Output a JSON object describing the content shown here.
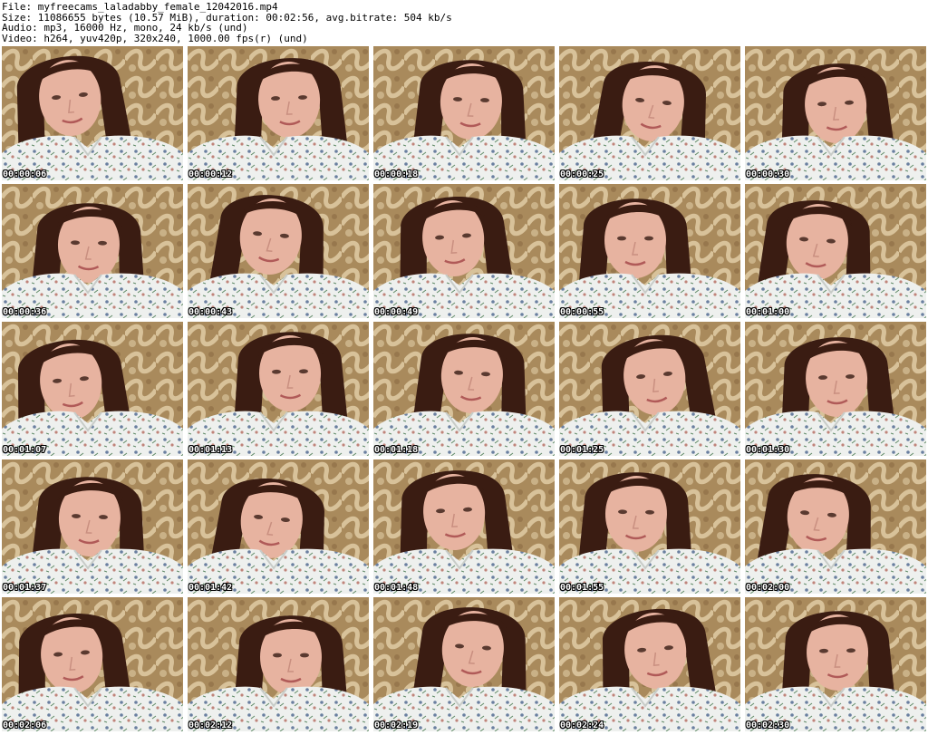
{
  "header": {
    "file_line": "File: myfreecams_laladabby_female_12042016.mp4",
    "size_line": "Size: 11086655 bytes (10.57 MiB), duration: 00:02:56, avg.bitrate: 504 kb/s",
    "audio_line": "Audio: mp3, 16000 Hz, mono, 24 kb/s (und)",
    "video_line": "Video: h264, yuv420p, 320x240, 1000.00 fps(r) (und)"
  },
  "thumbnails": [
    {
      "timestamp": "00:00:06"
    },
    {
      "timestamp": "00:00:12"
    },
    {
      "timestamp": "00:00:18"
    },
    {
      "timestamp": "00:00:25"
    },
    {
      "timestamp": "00:00:30"
    },
    {
      "timestamp": "00:00:36"
    },
    {
      "timestamp": "00:00:43"
    },
    {
      "timestamp": "00:00:49"
    },
    {
      "timestamp": "00:00:55"
    },
    {
      "timestamp": "00:01:00"
    },
    {
      "timestamp": "00:01:07"
    },
    {
      "timestamp": "00:01:13"
    },
    {
      "timestamp": "00:01:18"
    },
    {
      "timestamp": "00:01:25"
    },
    {
      "timestamp": "00:01:30"
    },
    {
      "timestamp": "00:01:37"
    },
    {
      "timestamp": "00:01:42"
    },
    {
      "timestamp": "00:01:48"
    },
    {
      "timestamp": "00:01:55"
    },
    {
      "timestamp": "00:02:00"
    },
    {
      "timestamp": "00:02:06"
    },
    {
      "timestamp": "00:02:12"
    },
    {
      "timestamp": "00:02:19"
    },
    {
      "timestamp": "00:02:24"
    },
    {
      "timestamp": "00:02:30"
    }
  ],
  "colors": {
    "wallpaper": "#a98a5c",
    "wallpaper_light": "#d8c29a",
    "hair": "#3a1c12",
    "skin": "#e7b3a0",
    "shirt": "#eef0ee",
    "flower": "#6a7fa0",
    "flower_alt": "#c0847a"
  }
}
